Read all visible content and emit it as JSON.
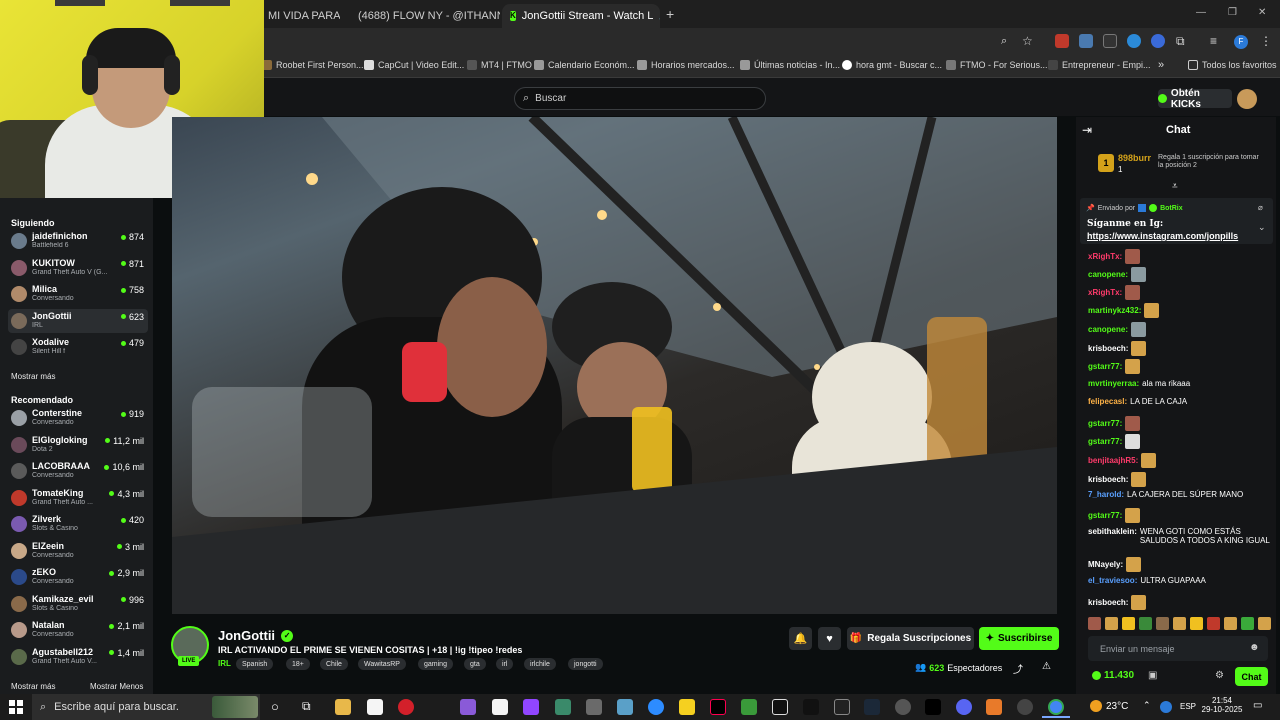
{
  "browser": {
    "tabs": [
      {
        "label": "MI VIDA PARA L"
      },
      {
        "label": "(4688) FLOW NY - @ITHANNY"
      },
      {
        "label": "JonGottii Stream - Watch L"
      }
    ],
    "new_tab": "+",
    "window_controls": [
      "—",
      "❐",
      "✕"
    ],
    "bookmarks": [
      "Roobet First Person...",
      "CapCut | Video Edit...",
      "MT4 | FTMO",
      "Calendario Económ...",
      "Horarios mercados...",
      "Últimas noticias - In...",
      "hora gmt - Buscar c...",
      "FTMO - For Serious...",
      "Entrepreneur - Empi...",
      "Todos los favoritos"
    ],
    "more": "»"
  },
  "kick": {
    "search_placeholder": "Buscar",
    "kicks_button": "Obtén KICKs"
  },
  "sidebar": {
    "following_title": "Siguiendo",
    "following": [
      {
        "name": "jaidefinichon",
        "game": "Battlefield 6",
        "viewers": "874",
        "color": "#6a7b8c"
      },
      {
        "name": "KUKITOW",
        "game": "Grand Theft Auto V (G...",
        "viewers": "871",
        "color": "#8a5a6a"
      },
      {
        "name": "Milica",
        "game": "Conversando",
        "viewers": "758",
        "color": "#b08a6a"
      },
      {
        "name": "JonGottii",
        "game": "IRL",
        "viewers": "623",
        "color": "#7a6a5a"
      },
      {
        "name": "Xodalive",
        "game": "Silent Hill f",
        "viewers": "479",
        "color": "#444444"
      }
    ],
    "show_more_1": "Mostrar más",
    "recommended_title": "Recomendado",
    "recommended": [
      {
        "name": "Conterstine",
        "game": "Conversando",
        "viewers": "919",
        "color": "#9aa0a6"
      },
      {
        "name": "ElGlogloking",
        "game": "Dota 2",
        "viewers": "11,2 mil",
        "color": "#6a4a5a"
      },
      {
        "name": "LACOBRAAA",
        "game": "Conversando",
        "viewers": "10,6 mil",
        "color": "#5a5a5a"
      },
      {
        "name": "TomateKing",
        "game": "Grand Theft Auto ...",
        "viewers": "4,3 mil",
        "color": "#c0392b"
      },
      {
        "name": "Zilverk",
        "game": "Slots & Casino",
        "viewers": "420",
        "color": "#7a5ab0"
      },
      {
        "name": "ElZeein",
        "game": "Conversando",
        "viewers": "3 mil",
        "color": "#c8a888"
      },
      {
        "name": "zEKO",
        "game": "Conversando",
        "viewers": "2,9 mil",
        "color": "#2b4a8a"
      },
      {
        "name": "Kamikaze_evil",
        "game": "Slots & Casino",
        "viewers": "996",
        "color": "#8a6a4a"
      },
      {
        "name": "Natalan",
        "game": "Conversando",
        "viewers": "2,1 mil",
        "color": "#b89a8a"
      },
      {
        "name": "Agustabell212",
        "game": "Grand Theft Auto V...",
        "viewers": "1,4 mil",
        "color": "#5a6a4a"
      }
    ],
    "show_more_2": "Mostrar más",
    "show_less": "Mostrar Menos"
  },
  "stream": {
    "streamer": "JonGottii",
    "live_badge": "LIVE",
    "title": "IRL ACTIVANDO EL PRIME SE VIENEN COSITAS  | +18 | !ig !tipeo !redes",
    "category": "IRL",
    "tags": [
      "Spanish",
      "18+",
      "Chile",
      "WawitasRP",
      "gaming",
      "gta",
      "irl",
      "irlchile",
      "jongotti"
    ],
    "gift_subs": "Regala Suscripciones",
    "subscribe": "Suscribirse",
    "viewers": "623",
    "viewers_label": "Espectadores"
  },
  "chat": {
    "title": "Chat",
    "top_gifter": {
      "name": "898burr",
      "count": "1",
      "text": "Regala 1 suscripción para tomar la posición 2"
    },
    "pinned": {
      "sent_by": "Enviado por",
      "bot": "BotRix",
      "message": "Síganme en Ig:",
      "link": "https://www.instagram.com/jonpills"
    },
    "messages": [
      {
        "user": "xRighTx:",
        "color": "#ff3b6b",
        "text": "",
        "emote": "#a05a4a"
      },
      {
        "user": "canopene:",
        "color": "#53fc18",
        "text": "",
        "emote": "#8a9aa0"
      },
      {
        "user": "xRighTx:",
        "color": "#ff3b6b",
        "text": "",
        "emote": "#a05a4a"
      },
      {
        "user": "martinykz432:",
        "color": "#53fc18",
        "text": "",
        "emote": "#d4a24a"
      },
      {
        "user": "canopene:",
        "color": "#53fc18",
        "text": "",
        "emote": "#8a9aa0"
      },
      {
        "user": "krisboech:",
        "color": "#ffffff",
        "text": "",
        "emote": "#d4a24a"
      },
      {
        "user": "gstarr77:",
        "color": "#53fc18",
        "text": "",
        "emote": "#d4a24a"
      },
      {
        "user": "mvrtinyerraa:",
        "color": "#53fc18",
        "text": "ala ma rikaaa",
        "emote": ""
      },
      {
        "user": "felipecasl:",
        "color": "#ffb347",
        "text": "LA DE LA CAJA",
        "emote": ""
      },
      {
        "user": "gstarr77:",
        "color": "#53fc18",
        "text": "",
        "emote": "#a05a4a"
      },
      {
        "user": "gstarr77:",
        "color": "#53fc18",
        "text": "",
        "emote": "#dddddd"
      },
      {
        "user": "benjitaajhR5:",
        "color": "#ff3b6b",
        "text": "",
        "emote": "#d4a24a"
      },
      {
        "user": "krisboech:",
        "color": "#ffffff",
        "text": "",
        "emote": "#d4a24a"
      },
      {
        "user": "7_harold:",
        "color": "#5aa0ff",
        "text": "LA CAJERA DEL SÚPER MANO",
        "emote": ""
      },
      {
        "user": "gstarr77:",
        "color": "#53fc18",
        "text": "",
        "emote": "#d4a24a"
      },
      {
        "user": "sebithaklein:",
        "color": "#ffffff",
        "text": "WENA GOTI COMO ESTÁS",
        "text2": "SALUDOS A TODOS A KING IGUAL",
        "emote": ""
      },
      {
        "user": "MNayely:",
        "color": "#ffffff",
        "text": "",
        "emote": "#d4a24a"
      },
      {
        "user": "el_traviesoo:",
        "color": "#5aa0ff",
        "text": "ULTRA GUAPAAA",
        "emote": ""
      },
      {
        "user": "krisboech:",
        "color": "#ffffff",
        "text": "",
        "emote": "#d4a24a"
      }
    ],
    "input_placeholder": "Enviar un mensaje",
    "kicks_balance": "11.430",
    "send_button": "Chat"
  },
  "taskbar": {
    "search_placeholder": "Escribe aquí para buscar.",
    "weather": "23°C",
    "language": "ESP",
    "time": "21:54",
    "date": "29-10-2025"
  }
}
